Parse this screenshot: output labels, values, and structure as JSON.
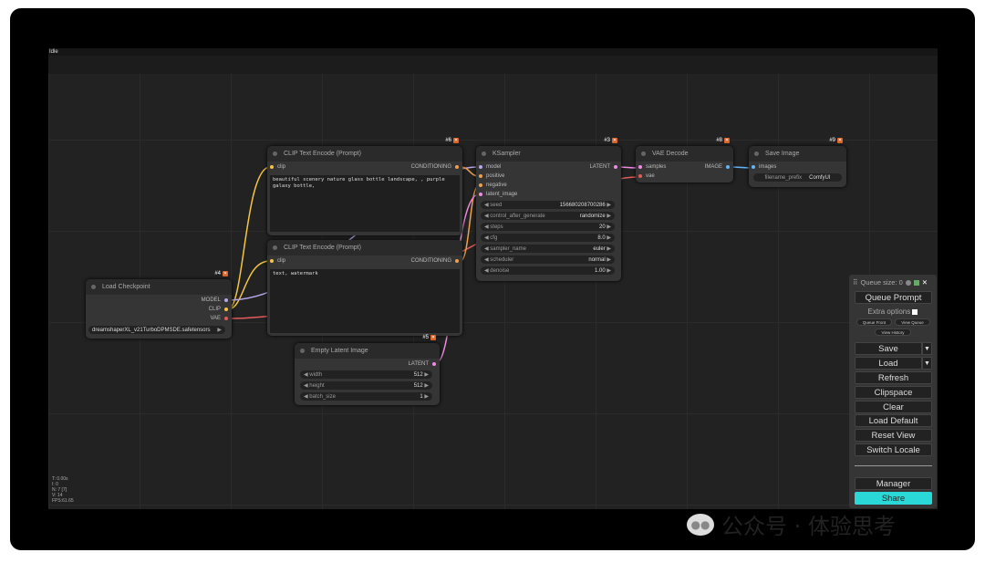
{
  "status": "Idle",
  "nodes": {
    "clip1": {
      "title": "CLIP Text Encode (Prompt)",
      "id": "#6",
      "in_clip": "clip",
      "out": "CONDITIONING",
      "text": "beautiful scenery nature glass bottle landscape, , purple galaxy bottle,"
    },
    "clip2": {
      "title": "CLIP Text Encode (Prompt)",
      "in_clip": "clip",
      "out": "CONDITIONING",
      "text": "text, watermark"
    },
    "ksampler": {
      "title": "KSampler",
      "id": "#3",
      "out": "LATENT",
      "inputs": [
        "model",
        "positive",
        "negative",
        "latent_image"
      ],
      "widgets": [
        {
          "label": "seed",
          "value": "156680208700286"
        },
        {
          "label": "control_after_generate",
          "value": "randomize"
        },
        {
          "label": "steps",
          "value": "20"
        },
        {
          "label": "cfg",
          "value": "8.0"
        },
        {
          "label": "sampler_name",
          "value": "euler"
        },
        {
          "label": "scheduler",
          "value": "normal"
        },
        {
          "label": "denoise",
          "value": "1.00"
        }
      ]
    },
    "vae": {
      "title": "VAE Decode",
      "id": "#8",
      "in1": "samples",
      "in2": "vae",
      "out": "IMAGE"
    },
    "save": {
      "title": "Save Image",
      "id": "#9",
      "in1": "images",
      "widget_label": "filename_prefix",
      "widget_value": "ComfyUI"
    },
    "load": {
      "title": "Load Checkpoint",
      "id": "#4",
      "out1": "MODEL",
      "out2": "CLIP",
      "out3": "VAE",
      "ckpt": "dreamshaperXL_v21TurboDPMSDE.safetensors"
    },
    "latent": {
      "title": "Empty Latent Image",
      "id": "#5",
      "out": "LATENT",
      "widgets": [
        {
          "label": "width",
          "value": "512"
        },
        {
          "label": "height",
          "value": "512"
        },
        {
          "label": "batch_size",
          "value": "1"
        }
      ]
    }
  },
  "stats": [
    "T: 0.00s",
    "I: 0",
    "N: 7 [7]",
    "V: 14",
    "FPS:61.65"
  ],
  "menu": {
    "queue_size": "Queue size: 0",
    "queue_prompt": "Queue Prompt",
    "extra_options": "Extra options",
    "queue_front": "Queue Front",
    "view_queue": "View Queue",
    "view_history": "View History",
    "save": "Save",
    "load": "Load",
    "refresh": "Refresh",
    "clipspace": "Clipspace",
    "clear": "Clear",
    "load_default": "Load Default",
    "reset_view": "Reset View",
    "switch_locale": "Switch Locale",
    "manager": "Manager",
    "share": "Share",
    "share_color": "#2ad8d8"
  },
  "watermark": {
    "text": "公众号 · 体验思考"
  }
}
